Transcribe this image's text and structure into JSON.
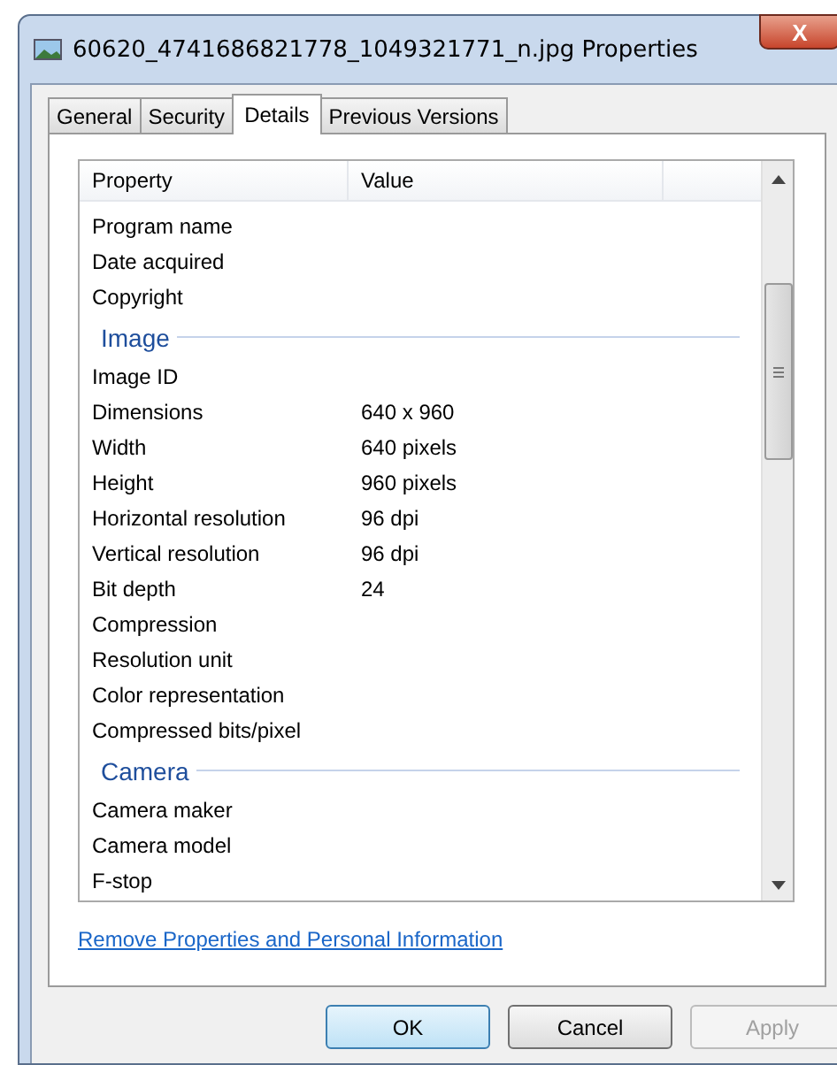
{
  "window": {
    "title": "60620_4741686821778_1049321771_n.jpg Properties",
    "close": "X"
  },
  "tabs": [
    {
      "label": "General",
      "selected": false
    },
    {
      "label": "Security",
      "selected": false
    },
    {
      "label": "Details",
      "selected": true
    },
    {
      "label": "Previous Versions",
      "selected": false
    }
  ],
  "table": {
    "columns": [
      "Property",
      "Value"
    ],
    "rows": [
      {
        "kind": "row",
        "property": "Program name"
      },
      {
        "kind": "row",
        "property": "Date acquired"
      },
      {
        "kind": "row",
        "property": "Copyright"
      },
      {
        "kind": "section",
        "property": "Image"
      },
      {
        "kind": "row",
        "property": "Image ID"
      },
      {
        "kind": "row",
        "property": "Dimensions",
        "value": "640 x 960"
      },
      {
        "kind": "row",
        "property": "Width",
        "value": "640 pixels"
      },
      {
        "kind": "row",
        "property": "Height",
        "value": "960 pixels"
      },
      {
        "kind": "row",
        "property": "Horizontal resolution",
        "value": "96 dpi"
      },
      {
        "kind": "row",
        "property": "Vertical resolution",
        "value": "96 dpi"
      },
      {
        "kind": "row",
        "property": "Bit depth",
        "value": "24"
      },
      {
        "kind": "row",
        "property": "Compression"
      },
      {
        "kind": "row",
        "property": "Resolution unit"
      },
      {
        "kind": "row",
        "property": "Color representation"
      },
      {
        "kind": "row",
        "property": "Compressed bits/pixel"
      },
      {
        "kind": "section",
        "property": "Camera"
      },
      {
        "kind": "row",
        "property": "Camera maker"
      },
      {
        "kind": "row",
        "property": "Camera model"
      },
      {
        "kind": "row",
        "property": "F-stop"
      }
    ]
  },
  "link": "Remove Properties and Personal Information",
  "buttons": [
    {
      "label": "OK",
      "default": true,
      "disabled": false
    },
    {
      "label": "Cancel",
      "default": false,
      "disabled": false
    },
    {
      "label": "Apply",
      "default": false,
      "disabled": true
    }
  ]
}
